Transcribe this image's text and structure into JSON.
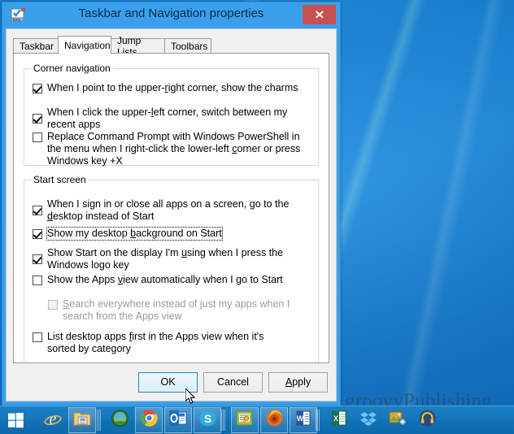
{
  "window": {
    "title": "Taskbar and Navigation properties",
    "icon": "taskbar-properties-icon",
    "close_label": "✕"
  },
  "tabs": [
    {
      "label": "Taskbar",
      "active": false
    },
    {
      "label": "Navigation",
      "active": true
    },
    {
      "label": "Jump Lists",
      "active": false
    },
    {
      "label": "Toolbars",
      "active": false
    }
  ],
  "groups": {
    "corner_navigation": {
      "title": "Corner navigation",
      "options": [
        {
          "pre": "When I point to the upper-",
          "accel": "r",
          "post": "ight corner, show the charms",
          "checked": true,
          "disabled": false,
          "focused": false
        },
        {
          "pre": "When I click the upper-",
          "accel": "l",
          "post": "eft corner, switch between my recent apps",
          "checked": true,
          "disabled": false,
          "focused": false
        },
        {
          "pre": "Replace Command Prompt with Windows PowerShell in the menu when I right-click the lower-left ",
          "accel": "c",
          "post": "orner or press Windows key +X",
          "checked": false,
          "disabled": false,
          "focused": false
        }
      ]
    },
    "start_screen": {
      "title": "Start screen",
      "options": [
        {
          "pre": "When I sign in or close all apps on a screen, go to the ",
          "accel": "d",
          "post": "esktop instead of Start",
          "checked": true,
          "disabled": false,
          "focused": false
        },
        {
          "pre": "Show my desktop ",
          "accel": "b",
          "post": "ackground on Start",
          "checked": true,
          "disabled": false,
          "focused": true
        },
        {
          "pre": "Show Start on the display I'm ",
          "accel": "u",
          "post": "sing when I press the Windows logo key",
          "checked": true,
          "disabled": false,
          "focused": false
        },
        {
          "pre": "Show the Apps ",
          "accel": "v",
          "post": "iew automatically when I go to Start",
          "checked": false,
          "disabled": false,
          "focused": false
        },
        {
          "pre": "",
          "accel": "S",
          "post": "earch everywhere instead of just my apps when I search from the Apps view",
          "checked": false,
          "disabled": true,
          "focused": false
        },
        {
          "pre": "List desktop apps ",
          "accel": "f",
          "post": "irst in the Apps view when it's sorted by category",
          "checked": false,
          "disabled": false,
          "focused": false
        }
      ]
    }
  },
  "buttons": [
    {
      "label": "OK",
      "hovered": true
    },
    {
      "label": "Cancel",
      "hovered": false
    },
    {
      "label": "Apply",
      "accel": "A",
      "hovered": false
    }
  ],
  "desktop": {
    "watermark": "groovyPublishing"
  },
  "taskbar": {
    "start_label": "start-button",
    "items": [
      {
        "name": "internet-explorer-icon",
        "running": false
      },
      {
        "name": "file-explorer-icon",
        "running": true
      },
      {
        "name": "media-center-icon",
        "running": false
      },
      {
        "name": "google-chrome-icon",
        "running": true
      },
      {
        "name": "outlook-icon",
        "running": true
      },
      {
        "name": "skype-icon",
        "running": true
      },
      {
        "name": "notepad-icon",
        "running": true
      },
      {
        "name": "firefox-icon",
        "running": true
      },
      {
        "name": "word-icon",
        "running": true
      },
      {
        "name": "excel-icon",
        "running": false
      },
      {
        "name": "dropbox-icon",
        "running": false
      },
      {
        "name": "image-editor-icon",
        "running": false
      },
      {
        "name": "headphones-icon",
        "running": false
      }
    ]
  },
  "colors": {
    "accent_blue": "#1383d6",
    "close_red": "#c75050",
    "dialog_chrome": "#3aa0ed",
    "dialog_face": "#f0f0f0"
  }
}
